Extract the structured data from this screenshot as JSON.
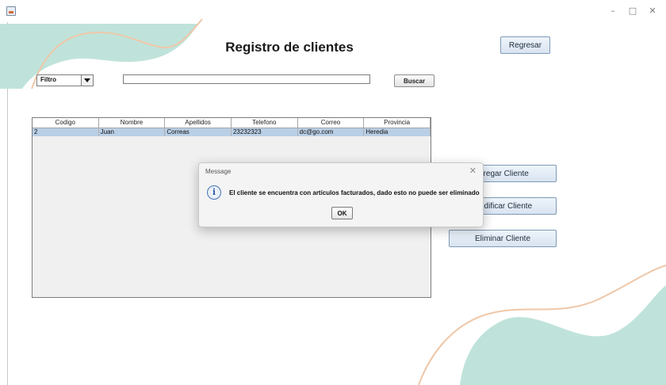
{
  "window": {
    "minimize": "–",
    "maximize": "□",
    "close": "✕"
  },
  "page": {
    "title": "Registro de clientes"
  },
  "buttons": {
    "regresar": "Regresar",
    "buscar": "Buscar",
    "agregar": "gregar Cliente",
    "modificar": "odificar Cliente",
    "eliminar": "Eliminar Cliente"
  },
  "filter": {
    "selected": "Filtro"
  },
  "search": {
    "value": ""
  },
  "table": {
    "columns": [
      "Codigo",
      "Nombre",
      "Apellidos",
      "Telefono",
      "Correo",
      "Provincia"
    ],
    "rows": [
      [
        "2",
        "Juan",
        "Correas",
        "23232323",
        "dc@go.com",
        "Heredia"
      ]
    ]
  },
  "dialog": {
    "title": "Message",
    "close": "✕",
    "icon": "i",
    "message": "El cliente se encuentra con artículos facturados, dado esto no puede ser eliminado",
    "ok": "OK"
  },
  "colors": {
    "teal": "#bfe3da",
    "peach": "#efc7a8"
  }
}
